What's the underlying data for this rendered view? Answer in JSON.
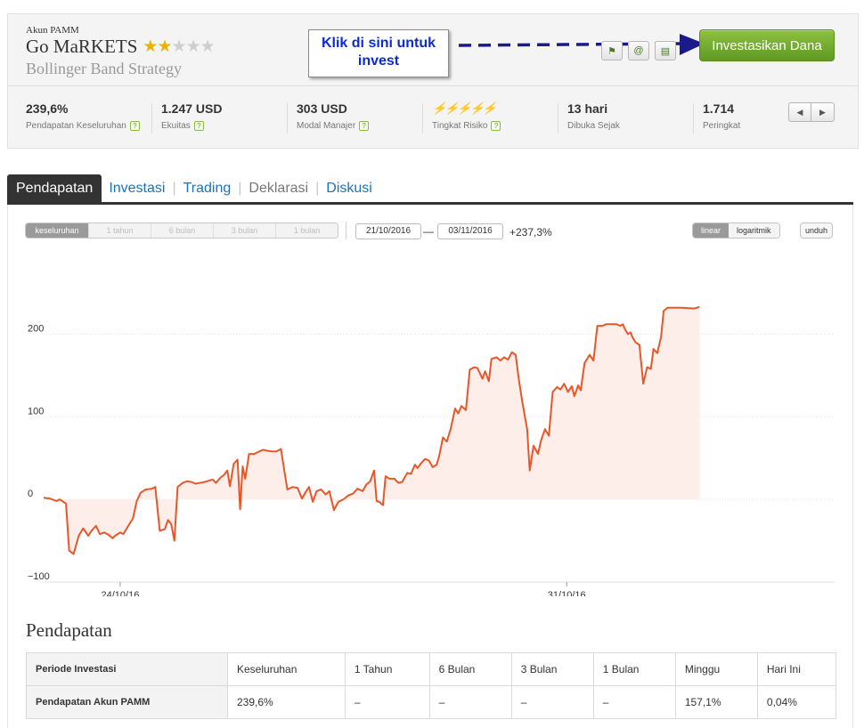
{
  "account": {
    "type_label": "Akun PAMM",
    "name": "Go MaRKETS",
    "rating_stars": 2,
    "rating_max": 5,
    "strategy": "Bollinger Band Strategy"
  },
  "callout": {
    "text": "Klik di sini untuk invest"
  },
  "header": {
    "invest_button": "Investasikan Dana",
    "icons": [
      "bookmark-icon",
      "at-icon",
      "document-icon"
    ]
  },
  "stats": [
    {
      "value": "239,6%",
      "label": "Pendapatan Keseluruhan",
      "help": true
    },
    {
      "value": "1.247 USD",
      "label": "Ekuitas",
      "help": true
    },
    {
      "value": "303 USD",
      "label": "Modal Manajer",
      "help": true
    },
    {
      "value": "⚡⚡⚡⚡⚡",
      "label": "Tingkat Risiko",
      "help": true,
      "risk": true
    },
    {
      "value": "13 hari",
      "label": "Dibuka Sejak",
      "help": false
    },
    {
      "value": "1.714",
      "label": "Peringkat",
      "help": false
    }
  ],
  "tabs": [
    {
      "label": "Pendapatan",
      "state": "active"
    },
    {
      "label": "Investasi",
      "state": "link"
    },
    {
      "label": "Trading",
      "state": "link"
    },
    {
      "label": "Deklarasi",
      "state": "muted"
    },
    {
      "label": "Diskusi",
      "state": "link"
    }
  ],
  "chart_controls": {
    "ranges": [
      "keseluruhan",
      "1 tahun",
      "6 bulan",
      "3 bulan",
      "1 bulan"
    ],
    "active_range": "keseluruhan",
    "date_from": "21/10/2016",
    "date_to": "03/11/2016",
    "change": "+237,3%",
    "scales": [
      "linear",
      "logaritmik"
    ],
    "active_scale": "linear",
    "download": "unduh"
  },
  "chart_data": {
    "type": "area",
    "title": "",
    "xlabel": "",
    "ylabel": "",
    "ylim": [
      -100,
      250
    ],
    "y_ticks": [
      {
        "value": 200,
        "label": "200"
      },
      {
        "value": 100,
        "label": "100"
      },
      {
        "value": 0,
        "label": "0"
      },
      {
        "value": -100,
        "label": "−100"
      }
    ],
    "x_ticks": [
      {
        "x": 3,
        "label": "24/10/16"
      },
      {
        "x": 10,
        "label": "31/10/16"
      }
    ],
    "xlim": [
      1.8,
      14.2
    ],
    "series": [
      {
        "color": "#e8572a",
        "points": [
          [
            1.8,
            2
          ],
          [
            1.9,
            1
          ],
          [
            2.0,
            -2
          ],
          [
            2.05,
            0
          ],
          [
            2.15,
            -5
          ],
          [
            2.2,
            -62
          ],
          [
            2.27,
            -66
          ],
          [
            2.35,
            -44
          ],
          [
            2.42,
            -35
          ],
          [
            2.5,
            -44
          ],
          [
            2.55,
            -38
          ],
          [
            2.62,
            -32
          ],
          [
            2.68,
            -42
          ],
          [
            2.75,
            -40
          ],
          [
            2.82,
            -43
          ],
          [
            2.88,
            -47
          ],
          [
            2.92,
            -44
          ],
          [
            3.0,
            -40
          ],
          [
            3.05,
            -42
          ],
          [
            3.12,
            -33
          ],
          [
            3.2,
            -23
          ],
          [
            3.26,
            -2
          ],
          [
            3.32,
            8
          ],
          [
            3.4,
            12
          ],
          [
            3.5,
            13
          ],
          [
            3.55,
            15
          ],
          [
            3.62,
            -38
          ],
          [
            3.7,
            -36
          ],
          [
            3.75,
            -25
          ],
          [
            3.8,
            -30
          ],
          [
            3.85,
            -50
          ],
          [
            3.9,
            15
          ],
          [
            3.98,
            20
          ],
          [
            4.05,
            22
          ],
          [
            4.12,
            21
          ],
          [
            4.18,
            19
          ],
          [
            4.25,
            20
          ],
          [
            4.32,
            21
          ],
          [
            4.4,
            23
          ],
          [
            4.45,
            24
          ],
          [
            4.5,
            20
          ],
          [
            4.58,
            27
          ],
          [
            4.62,
            29
          ],
          [
            4.68,
            35
          ],
          [
            4.72,
            16
          ],
          [
            4.78,
            43
          ],
          [
            4.84,
            48
          ],
          [
            4.88,
            -12
          ],
          [
            4.92,
            40
          ],
          [
            4.96,
            25
          ],
          [
            5.02,
            55
          ],
          [
            5.1,
            55
          ],
          [
            5.18,
            58
          ],
          [
            5.24,
            60
          ],
          [
            5.3,
            59
          ],
          [
            5.38,
            58
          ],
          [
            5.45,
            58
          ],
          [
            5.52,
            61
          ],
          [
            5.62,
            12
          ],
          [
            5.7,
            15
          ],
          [
            5.78,
            14
          ],
          [
            5.85,
            1
          ],
          [
            5.9,
            8
          ],
          [
            5.96,
            15
          ],
          [
            6.02,
            -3
          ],
          [
            6.08,
            10
          ],
          [
            6.15,
            12
          ],
          [
            6.22,
            6
          ],
          [
            6.28,
            10
          ],
          [
            6.35,
            -13
          ],
          [
            6.42,
            -3
          ],
          [
            6.5,
            0
          ],
          [
            6.58,
            5
          ],
          [
            6.65,
            7
          ],
          [
            6.72,
            13
          ],
          [
            6.8,
            10
          ],
          [
            6.86,
            18
          ],
          [
            6.92,
            22
          ],
          [
            6.98,
            35
          ],
          [
            7.02,
            -2
          ],
          [
            7.06,
            -3
          ],
          [
            7.12,
            -7
          ],
          [
            7.16,
            28
          ],
          [
            7.22,
            25
          ],
          [
            7.3,
            25
          ],
          [
            7.36,
            20
          ],
          [
            7.42,
            21
          ],
          [
            7.5,
            32
          ],
          [
            7.56,
            31
          ],
          [
            7.62,
            42
          ],
          [
            7.66,
            38
          ],
          [
            7.72,
            44
          ],
          [
            7.78,
            49
          ],
          [
            7.84,
            47
          ],
          [
            7.9,
            39
          ],
          [
            7.96,
            42
          ],
          [
            8.0,
            52
          ],
          [
            8.06,
            75
          ],
          [
            8.12,
            70
          ],
          [
            8.18,
            85
          ],
          [
            8.25,
            110
          ],
          [
            8.3,
            104
          ],
          [
            8.35,
            113
          ],
          [
            8.42,
            108
          ],
          [
            8.48,
            157
          ],
          [
            8.55,
            160
          ],
          [
            8.6,
            159
          ],
          [
            8.68,
            146
          ],
          [
            8.72,
            155
          ],
          [
            8.78,
            143
          ],
          [
            8.82,
            170
          ],
          [
            8.9,
            172
          ],
          [
            8.96,
            168
          ],
          [
            9.02,
            172
          ],
          [
            9.08,
            169
          ],
          [
            9.14,
            178
          ],
          [
            9.2,
            175
          ],
          [
            9.25,
            145
          ],
          [
            9.3,
            120
          ],
          [
            9.35,
            98
          ],
          [
            9.38,
            85
          ],
          [
            9.42,
            35
          ],
          [
            9.48,
            65
          ],
          [
            9.55,
            55
          ],
          [
            9.6,
            72
          ],
          [
            9.66,
            85
          ],
          [
            9.72,
            77
          ],
          [
            9.78,
            130
          ],
          [
            9.85,
            136
          ],
          [
            9.9,
            133
          ],
          [
            9.96,
            140
          ],
          [
            10.02,
            130
          ],
          [
            10.08,
            137
          ],
          [
            10.12,
            125
          ],
          [
            10.18,
            138
          ],
          [
            10.22,
            132
          ],
          [
            10.28,
            165
          ],
          [
            10.36,
            175
          ],
          [
            10.42,
            168
          ],
          [
            10.48,
            210
          ],
          [
            10.56,
            210
          ],
          [
            10.62,
            212
          ],
          [
            10.7,
            212
          ],
          [
            10.78,
            212
          ],
          [
            10.84,
            210
          ],
          [
            10.88,
            212
          ],
          [
            10.92,
            205
          ],
          [
            10.96,
            200
          ],
          [
            11.0,
            202
          ],
          [
            11.04,
            195
          ],
          [
            11.08,
            190
          ],
          [
            11.14,
            187
          ],
          [
            11.2,
            140
          ],
          [
            11.26,
            160
          ],
          [
            11.32,
            158
          ],
          [
            11.36,
            182
          ],
          [
            11.42,
            177
          ],
          [
            11.48,
            197
          ],
          [
            11.52,
            228
          ],
          [
            11.58,
            232
          ],
          [
            11.66,
            232
          ],
          [
            11.8,
            232
          ],
          [
            12.0,
            231
          ],
          [
            12.08,
            233
          ]
        ]
      }
    ]
  },
  "returns_section": {
    "title": "Pendapatan",
    "header_row": [
      "Periode Investasi",
      "Keseluruhan",
      "1 Tahun",
      "6 Bulan",
      "3 Bulan",
      "1 Bulan",
      "Minggu",
      "Hari Ini"
    ],
    "value_row": [
      "Pendapatan Akun PAMM",
      "239,6%",
      "–",
      "–",
      "–",
      "–",
      "157,1%",
      "0,04%"
    ]
  }
}
